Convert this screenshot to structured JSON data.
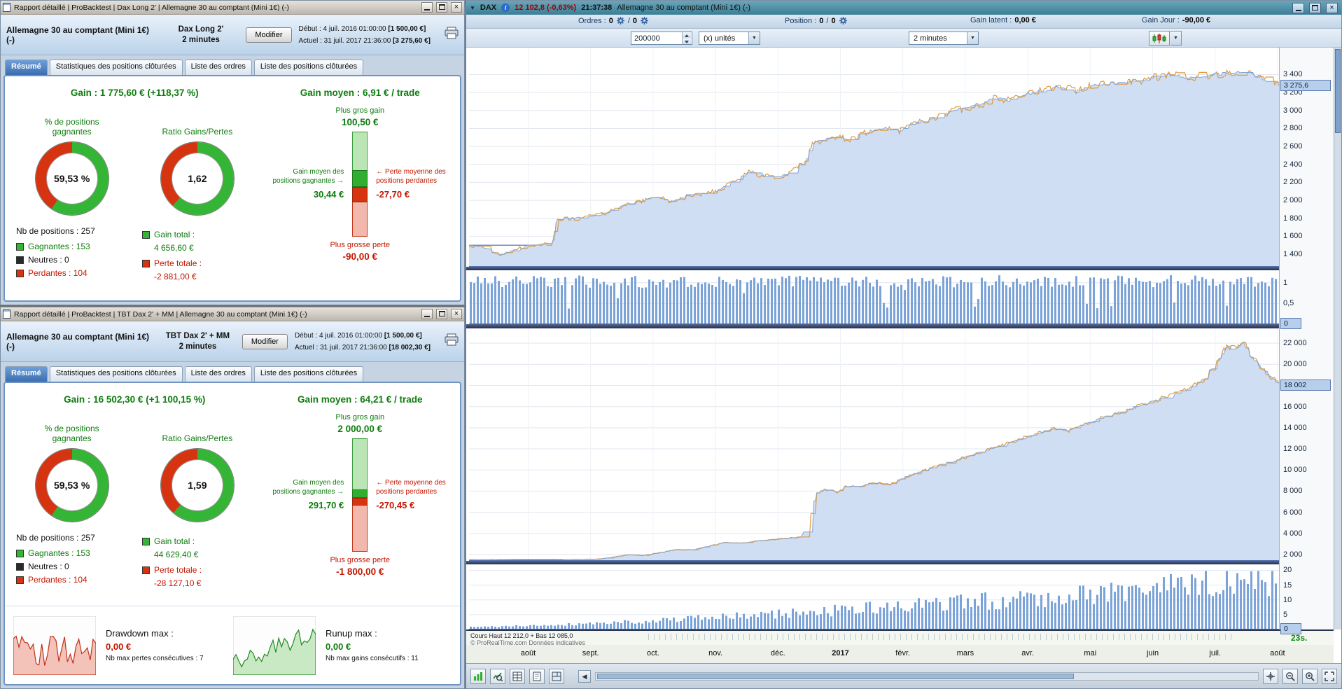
{
  "colors": {
    "gain_green": "#0e7c0e",
    "loss_red": "#c41700",
    "accent_blue": "#3a6eb0",
    "equity_fill": "#cfdef3",
    "volume_blue": "#7ba3d8"
  },
  "icons": {
    "dropdown": "▼",
    "close": "×",
    "scroll_left": "◀",
    "arrow_right": "→",
    "arrow_left": "←",
    "info": "i"
  },
  "report1": {
    "titlebar_text": "Rapport détaillé | ProBacktest | Dax Long 2' | Allemagne 30 au comptant (Mini 1€) (-)",
    "header": {
      "instrument": "Allemagne 30 au comptant (Mini 1€) (-)",
      "strategy": "Dax Long 2'",
      "timeframe": "2 minutes",
      "modify_button": "Modifier",
      "start_label": "Début :",
      "start_datetime": "4 juil. 2016 01:00:00",
      "start_capital": "[1 500,00 €]",
      "current_label": "Actuel :",
      "current_datetime": "31 juil. 2017 21:36:00",
      "current_capital": "[3 275,60 €]"
    },
    "tabs": [
      "Résumé",
      "Statistiques des positions clôturées",
      "Liste des ordres",
      "Liste des positions clôturées"
    ],
    "summary": {
      "gain_line": "Gain : 1 775,60 € (+118,37 %)",
      "pct_label": "% de positions gagnantes",
      "pct_value": "59,53 %",
      "pct_num": 59.53,
      "ratio_label": "Ratio Gains/Pertes",
      "ratio_value": "1,62",
      "ratio_num": 1.62,
      "nb_positions": "Nb de positions : 257",
      "legend_gagnantes": "Gagnantes : 153",
      "legend_neutres": "Neutres : 0",
      "legend_perdantes": "Perdantes : 104",
      "gain_total_label": "Gain total :",
      "gain_total_value": "4 656,60 €",
      "perte_totale_label": "Perte totale :",
      "perte_totale_value": "-2 881,00 €",
      "gain_moyen_line": "Gain moyen : 6,91 € / trade",
      "plus_gros_gain_label": "Plus gros gain",
      "plus_gros_gain_value": "100,50 €",
      "avg_win_label": "Gain moyen des positions gagnantes",
      "avg_win_value": "30,44 €",
      "avg_loss_label": "Perte moyenne des positions perdantes",
      "avg_loss_value": "-27,70 €",
      "plus_grosse_perte_label": "Plus grosse perte",
      "plus_grosse_perte_value": "-90,00 €",
      "bars": {
        "max_gain": 100.5,
        "avg_gain": 30.44,
        "avg_loss": 27.7,
        "max_loss": 90.0
      }
    }
  },
  "report2": {
    "titlebar_text": "Rapport détaillé | ProBacktest | TBT Dax 2' + MM | Allemagne 30 au comptant (Mini 1€) (-)",
    "header": {
      "instrument": "Allemagne 30 au comptant (Mini 1€) (-)",
      "strategy": "TBT Dax 2' + MM",
      "timeframe": "2 minutes",
      "modify_button": "Modifier",
      "start_label": "Début :",
      "start_datetime": "4 juil. 2016 01:00:00",
      "start_capital": "[1 500,00 €]",
      "current_label": "Actuel :",
      "current_datetime": "31 juil. 2017 21:36:00",
      "current_capital": "[18 002,30 €]"
    },
    "tabs": [
      "Résumé",
      "Statistiques des positions clôturées",
      "Liste des ordres",
      "Liste des positions clôturées"
    ],
    "summary": {
      "gain_line": "Gain : 16 502,30 € (+1 100,15 %)",
      "pct_label": "% de positions gagnantes",
      "pct_value": "59,53 %",
      "pct_num": 59.53,
      "ratio_label": "Ratio Gains/Pertes",
      "ratio_value": "1,59",
      "ratio_num": 1.59,
      "nb_positions": "Nb de positions : 257",
      "legend_gagnantes": "Gagnantes : 153",
      "legend_neutres": "Neutres : 0",
      "legend_perdantes": "Perdantes : 104",
      "gain_total_label": "Gain total :",
      "gain_total_value": "44 629,40 €",
      "perte_totale_label": "Perte totale :",
      "perte_totale_value": "-28 127,10 €",
      "gain_moyen_line": "Gain moyen : 64,21 € / trade",
      "plus_gros_gain_label": "Plus gros gain",
      "plus_gros_gain_value": "2 000,00 €",
      "avg_win_label": "Gain moyen des positions gagnantes",
      "avg_win_value": "291,70 €",
      "avg_loss_label": "Perte moyenne des positions perdantes",
      "avg_loss_value": "-270,45 €",
      "plus_grosse_perte_label": "Plus grosse perte",
      "plus_grosse_perte_value": "-1 800,00 €",
      "bars": {
        "max_gain": 2000,
        "avg_gain": 291.7,
        "avg_loss": 270.45,
        "max_loss": 1800
      }
    },
    "drawdown": {
      "dd_label": "Drawdown max :",
      "dd_value": "0,00 €",
      "dd_sub": "Nb max pertes consécutives : 7",
      "ru_label": "Runup max :",
      "ru_value": "0,00 €",
      "ru_sub": "Nb max gains consécutifs : 11"
    }
  },
  "chart_window": {
    "titlebar": {
      "symbol": "DAX",
      "price": "12 102,8 (-0,63%)",
      "time": "21:37:38",
      "instrument": "Allemagne 30 au comptant (Mini 1€) (-)"
    },
    "toolbar": {
      "ordres_label": "Ordres :",
      "ordres_a": "0",
      "ordres_b": "0",
      "position_label": "Position :",
      "position_a": "0",
      "position_b": "0",
      "gain_latent_label": "Gain latent :",
      "gain_latent_value": "0,00 €",
      "gain_jour_label": "Gain Jour :",
      "gain_jour_value": "-90,00 €",
      "quantity": "200000",
      "unit_option": "(x) unités",
      "timeframe_option": "2 minutes"
    },
    "status": {
      "cours": "Cours  Haut 12 212,0  + Bas 12 085,0",
      "watermark": "© ProRealTime.com  Données indicatives",
      "countdown": "23s."
    },
    "months": [
      "août",
      "sept.",
      "oct.",
      "nov.",
      "déc.",
      "2017",
      "févr.",
      "mars",
      "avr.",
      "mai",
      "juin",
      "juil.",
      "août"
    ]
  },
  "chart_data": [
    {
      "type": "area",
      "name": "equity-curve-dax-long-2",
      "ylim": [
        1260,
        3700
      ],
      "yticks": [
        3400,
        3200,
        3000,
        2800,
        2600,
        2400,
        2200,
        2000,
        1800,
        1600,
        1400
      ],
      "ytick_labels": [
        "3 400",
        "3 200",
        "3 000",
        "2 800",
        "2 600",
        "2 400",
        "2 200",
        "2 000",
        "1 800",
        "1 600",
        "1 400"
      ],
      "current": 3275.6,
      "current_label": "3 275,6",
      "baseline": 1500,
      "anchors": [
        [
          0,
          1500
        ],
        [
          0.02,
          1470
        ],
        [
          0.035,
          1400
        ],
        [
          0.05,
          1430
        ],
        [
          0.07,
          1490
        ],
        [
          0.09,
          1510
        ],
        [
          0.103,
          1520
        ],
        [
          0.108,
          1790
        ],
        [
          0.13,
          1800
        ],
        [
          0.15,
          1825
        ],
        [
          0.17,
          1860
        ],
        [
          0.19,
          1940
        ],
        [
          0.21,
          1990
        ],
        [
          0.23,
          2040
        ],
        [
          0.25,
          1985
        ],
        [
          0.27,
          2060
        ],
        [
          0.29,
          2075
        ],
        [
          0.31,
          2120
        ],
        [
          0.33,
          2230
        ],
        [
          0.345,
          2310
        ],
        [
          0.36,
          2280
        ],
        [
          0.38,
          2250
        ],
        [
          0.4,
          2330
        ],
        [
          0.415,
          2430
        ],
        [
          0.425,
          2640
        ],
        [
          0.45,
          2700
        ],
        [
          0.47,
          2680
        ],
        [
          0.49,
          2760
        ],
        [
          0.51,
          2810
        ],
        [
          0.53,
          2765
        ],
        [
          0.55,
          2860
        ],
        [
          0.57,
          2900
        ],
        [
          0.59,
          2980
        ],
        [
          0.61,
          3020
        ],
        [
          0.63,
          3060
        ],
        [
          0.65,
          3140
        ],
        [
          0.67,
          3110
        ],
        [
          0.69,
          3190
        ],
        [
          0.71,
          3230
        ],
        [
          0.73,
          3260
        ],
        [
          0.75,
          3210
        ],
        [
          0.77,
          3280
        ],
        [
          0.79,
          3300
        ],
        [
          0.81,
          3310
        ],
        [
          0.83,
          3330
        ],
        [
          0.85,
          3380
        ],
        [
          0.87,
          3405
        ],
        [
          0.885,
          3350
        ],
        [
          0.9,
          3380
        ],
        [
          0.92,
          3400
        ],
        [
          0.94,
          3415
        ],
        [
          0.96,
          3430
        ],
        [
          0.975,
          3380
        ],
        [
          0.99,
          3305
        ],
        [
          1,
          3276
        ]
      ]
    },
    {
      "type": "bar",
      "name": "trade-volume-1",
      "ylim": [
        0,
        1.3
      ],
      "yticks": [
        1,
        0.5,
        0
      ],
      "ytick_labels": [
        "1",
        "0,5",
        "0"
      ],
      "zero_label": "0",
      "profile": "flat"
    },
    {
      "type": "area",
      "name": "equity-curve-tbt-dax",
      "ylim": [
        1400,
        23400
      ],
      "yticks": [
        22000,
        20000,
        18000,
        16000,
        14000,
        12000,
        10000,
        8000,
        6000,
        4000,
        2000
      ],
      "ytick_labels": [
        "22 000",
        "20 000",
        "18 000",
        "16 000",
        "14 000",
        "12 000",
        "10 000",
        "8 000",
        "6 000",
        "4 000",
        "2 000"
      ],
      "current": 18002,
      "current_label": "18 002",
      "baseline": 1500,
      "anchors": [
        [
          0,
          1500
        ],
        [
          0.03,
          1470
        ],
        [
          0.06,
          1420
        ],
        [
          0.09,
          1400
        ],
        [
          0.11,
          1430
        ],
        [
          0.13,
          1520
        ],
        [
          0.155,
          1560
        ],
        [
          0.175,
          1700
        ],
        [
          0.195,
          1980
        ],
        [
          0.215,
          1900
        ],
        [
          0.235,
          2180
        ],
        [
          0.255,
          2480
        ],
        [
          0.275,
          2420
        ],
        [
          0.295,
          2780
        ],
        [
          0.315,
          3150
        ],
        [
          0.335,
          3080
        ],
        [
          0.355,
          3280
        ],
        [
          0.375,
          3420
        ],
        [
          0.395,
          3560
        ],
        [
          0.41,
          3650
        ],
        [
          0.42,
          5200
        ],
        [
          0.428,
          7800
        ],
        [
          0.44,
          8150
        ],
        [
          0.455,
          7900
        ],
        [
          0.468,
          8550
        ],
        [
          0.48,
          8400
        ],
        [
          0.5,
          8800
        ],
        [
          0.52,
          8650
        ],
        [
          0.54,
          9400
        ],
        [
          0.56,
          9900
        ],
        [
          0.58,
          10400
        ],
        [
          0.6,
          10900
        ],
        [
          0.62,
          11400
        ],
        [
          0.64,
          11900
        ],
        [
          0.66,
          12400
        ],
        [
          0.68,
          12900
        ],
        [
          0.7,
          13400
        ],
        [
          0.72,
          13900
        ],
        [
          0.74,
          13700
        ],
        [
          0.76,
          14400
        ],
        [
          0.78,
          14900
        ],
        [
          0.8,
          15400
        ],
        [
          0.82,
          15900
        ],
        [
          0.84,
          16400
        ],
        [
          0.86,
          16900
        ],
        [
          0.88,
          17400
        ],
        [
          0.895,
          18000
        ],
        [
          0.91,
          18800
        ],
        [
          0.925,
          20400
        ],
        [
          0.935,
          21700
        ],
        [
          0.945,
          21400
        ],
        [
          0.955,
          22050
        ],
        [
          0.963,
          21000
        ],
        [
          0.972,
          20100
        ],
        [
          0.982,
          19400
        ],
        [
          1,
          18002
        ]
      ]
    },
    {
      "type": "bar",
      "name": "trade-volume-2",
      "ylim": [
        0,
        22
      ],
      "yticks": [
        20,
        15,
        10,
        5,
        0
      ],
      "ytick_labels": [
        "20",
        "15",
        "10",
        "5",
        "0"
      ],
      "zero_label": "0",
      "profile": "rising"
    }
  ]
}
